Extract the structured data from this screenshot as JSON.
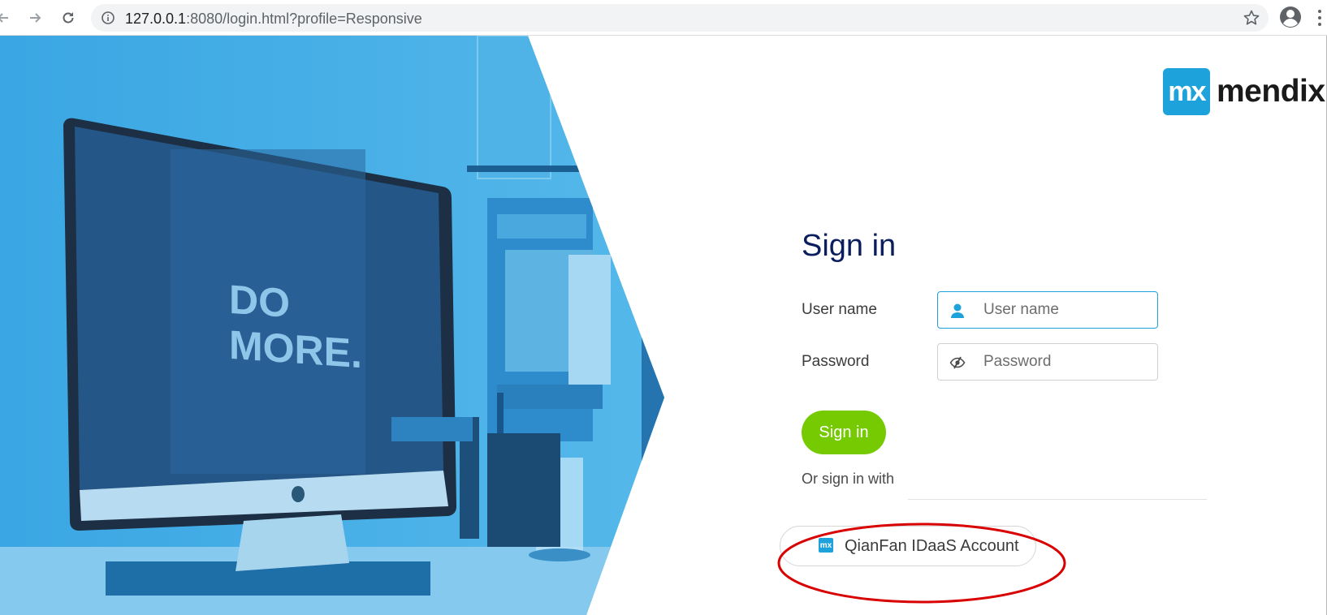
{
  "browser": {
    "url_host": "127.0.0.1",
    "url_rest": ":8080/login.html?profile=Responsive",
    "back_icon": "arrow-left-icon",
    "forward_icon": "arrow-right-icon",
    "reload_icon": "reload-icon",
    "info_icon": "info-icon",
    "bookmark_icon": "star-icon",
    "profile_icon": "account-circle-icon"
  },
  "photo": {
    "screen_text_line1": "DO",
    "screen_text_line2": "MORE.",
    "tint_color": "#1ea2dc"
  },
  "logo": {
    "mark": "mx",
    "word": "mendix",
    "color": "#1ea2dc"
  },
  "login": {
    "title": "Sign in",
    "username_label": "User name",
    "username_placeholder": "User name",
    "password_label": "Password",
    "password_placeholder": "Password",
    "submit_label": "Sign in",
    "submit_color": "#76ca02",
    "or_label": "Or sign in with",
    "sso_label": "QianFan IDaaS Account",
    "sso_icon_text": "mx"
  },
  "annotation": {
    "color": "#d80000"
  }
}
